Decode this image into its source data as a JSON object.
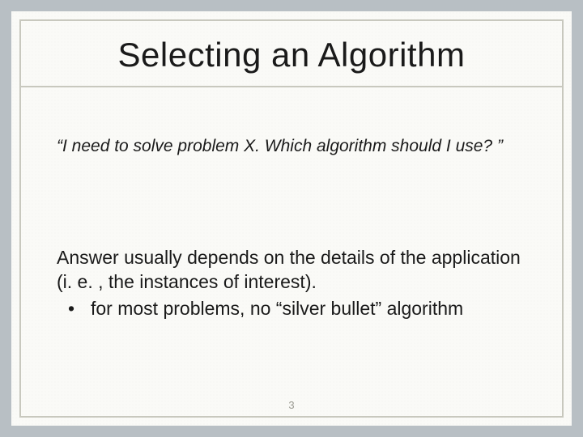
{
  "slide": {
    "title": "Selecting an Algorithm",
    "quote": "“I need to solve problem X.  Which algorithm should I use? ”",
    "answer": "Answer usually depends on the details of the application (i. e. , the instances of interest).",
    "bullets": [
      "for most problems, no “silver bullet” algorithm"
    ],
    "bullet_marker": "•",
    "page_number": "3"
  }
}
